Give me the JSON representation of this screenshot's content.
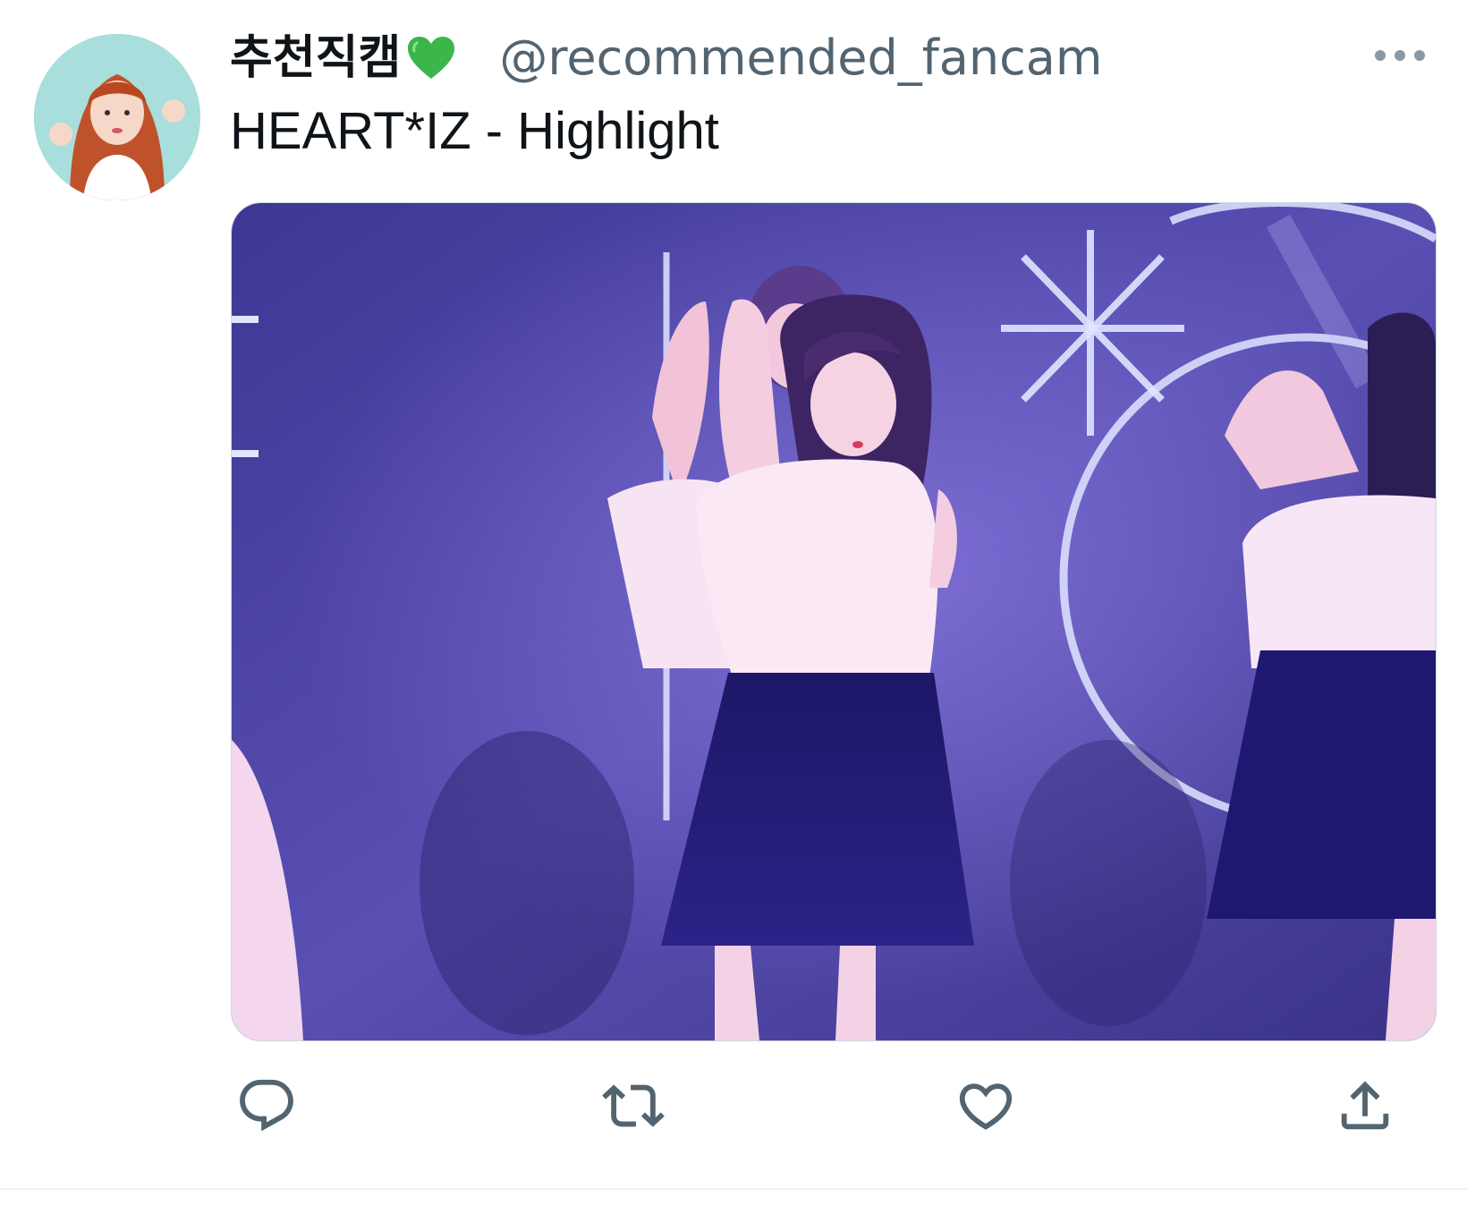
{
  "tweet": {
    "display_name": "추천직캠",
    "name_emoji": "green-heart-icon",
    "handle": "@recommended_fancam",
    "more_icon": "more-icon",
    "text": "HEART*IZ - Highlight"
  },
  "actions": [
    {
      "icon": "reply-icon"
    },
    {
      "icon": "retweet-icon"
    },
    {
      "icon": "like-icon"
    },
    {
      "icon": "share-icon"
    }
  ],
  "colors": {
    "text_primary": "#0f1419",
    "text_secondary": "#536471",
    "icon_color": "#536471",
    "heart_emoji": "#3cb54a",
    "media_background": "#4a3f9a"
  }
}
